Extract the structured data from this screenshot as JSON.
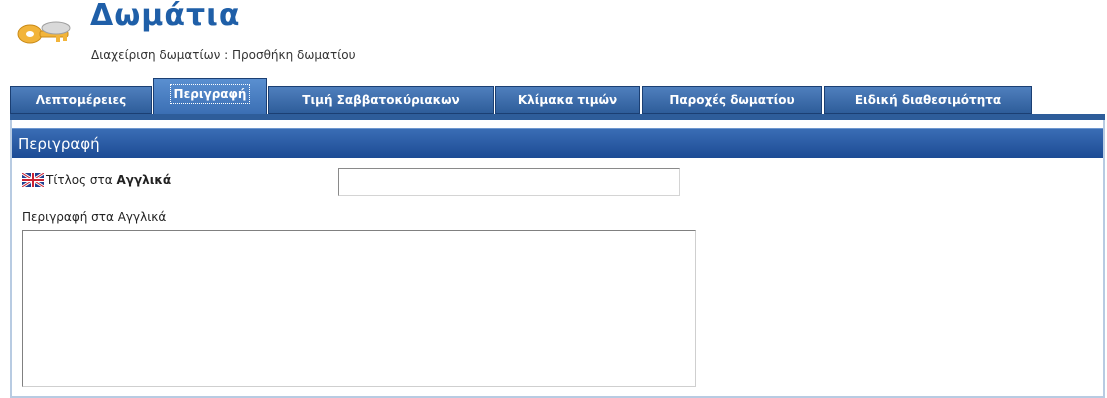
{
  "header": {
    "title": "Δωμάτια",
    "breadcrumb": "Διαχείριση δωματίων : Προσθήκη δωματίου",
    "icon": "keys-icon"
  },
  "tabs": [
    {
      "label": "Λεπτομέρειες",
      "active": false
    },
    {
      "label": "Περιγραφή",
      "active": true
    },
    {
      "label": "Τιμή Σαββατοκύριακων",
      "active": false
    },
    {
      "label": "Κλίμακα τιμών",
      "active": false
    },
    {
      "label": "Παροχές δωματίου",
      "active": false
    },
    {
      "label": "Ειδική διαθεσιμότητα",
      "active": false
    }
  ],
  "section": {
    "title": "Περιγραφή"
  },
  "form": {
    "title_label_prefix": "Τίτλος στα ",
    "title_label_bold": "Αγγλικά",
    "title_value": "",
    "flag_icon": "uk-flag-icon",
    "description_label": "Περιγραφή στα Αγγλικά",
    "description_value": ""
  },
  "colors": {
    "title": "#1f5fa8",
    "tab_bg": "#2e5d9a",
    "section_bg": "#1c4b94"
  }
}
